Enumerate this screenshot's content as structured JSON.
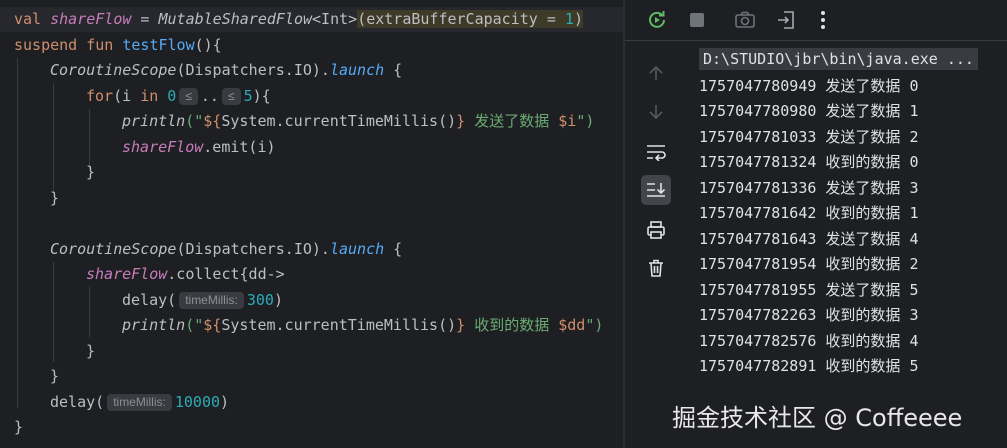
{
  "editor": {
    "line1": {
      "val": "val ",
      "name": "shareFlow",
      "eq": " = ",
      "cls": "MutableSharedFlow",
      "gen": "<Int>",
      "open": "(",
      "param": "extraBufferCapacity = ",
      "num": "1",
      "close": ")"
    },
    "line2": {
      "kw1": "suspend fun ",
      "fn": "testFlow",
      "rest": "(){"
    },
    "line3": {
      "cls": "CoroutineScope",
      "args": "(Dispatchers.IO).",
      "ext": "launch",
      "rest": " {"
    },
    "line4": {
      "kw": "for",
      "a": "(i ",
      "in": "in ",
      "n0": "0",
      "hint1": "≤",
      "dots": "..",
      "hint2": "≤",
      "n5": "5",
      "rest": "){"
    },
    "line5": {
      "fn": "println",
      "a": "(\"",
      "t1": "${",
      "call": "System.currentTimeMillis()",
      "t2": "}",
      "s": " 发送了数据 ",
      "var": "$i",
      "end": "\")"
    },
    "line6": {
      "name": "shareFlow",
      "rest": ".emit(i)"
    },
    "line7": {
      "text": "}"
    },
    "line8": {
      "text": "}"
    },
    "line10": {
      "cls": "CoroutineScope",
      "args": "(Dispatchers.IO).",
      "ext": "launch",
      "rest": " {"
    },
    "line11": {
      "name": "shareFlow",
      "rest": ".collect{dd->"
    },
    "line12": {
      "fn": "delay(",
      "hint": "timeMillis:",
      "num": "300",
      "end": ")"
    },
    "line13": {
      "fn": "println",
      "a": "(\"",
      "t1": "${",
      "call": "System.currentTimeMillis()",
      "t2": "}",
      "s": " 收到的数据 ",
      "var": "$dd",
      "end": "\")"
    },
    "line14": {
      "text": "}"
    },
    "line15": {
      "text": "}"
    },
    "line16": {
      "fn": "delay(",
      "hint": "timeMillis:",
      "num": "10000",
      "end": ")"
    },
    "line17": {
      "text": "}"
    }
  },
  "run_panel": {
    "command": "D:\\STUDIO\\jbr\\bin\\java.exe ...",
    "output": [
      "1757047780949 发送了数据 0",
      "1757047780980 发送了数据 1",
      "1757047781033 发送了数据 2",
      "1757047781324 收到的数据 0",
      "1757047781336 发送了数据 3",
      "1757047781642 收到的数据 1",
      "1757047781643 发送了数据 4",
      "1757047781954 收到的数据 2",
      "1757047781955 发送了数据 5",
      "1757047782263 收到的数据 3",
      "1757047782576 收到的数据 4",
      "1757047782891 收到的数据 5"
    ],
    "toolbar_icons": [
      "rerun-icon",
      "stop-icon",
      "camera-icon",
      "exit-icon",
      "more-icon"
    ],
    "sidebar_icons": [
      "arrow-up-icon",
      "arrow-down-icon",
      "soft-wrap-icon",
      "scroll-to-end-icon",
      "print-icon",
      "trash-icon"
    ]
  },
  "watermark": "掘金技术社区 @ Coffeeee",
  "colors": {
    "background": "#1e1f22",
    "keyword": "#cf8e6d",
    "function": "#56a8f5",
    "string": "#6aab73",
    "number": "#2aacb8",
    "property": "#c77dbb",
    "run_icon": "#5fb865"
  }
}
